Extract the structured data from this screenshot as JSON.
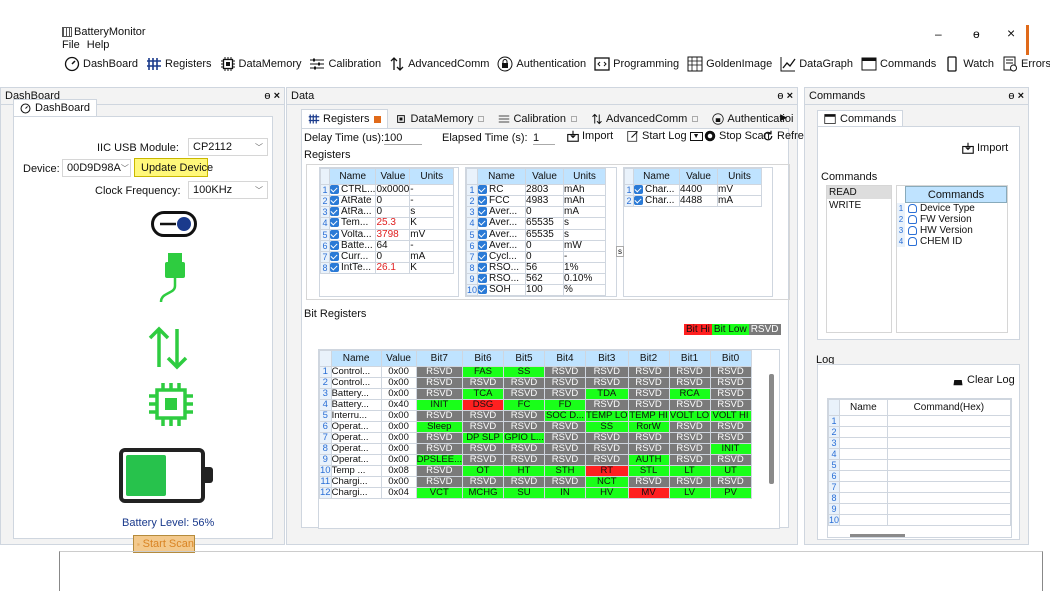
{
  "app": {
    "title": "BatteryMonitor",
    "minimize": "–",
    "maximize": "ɵ",
    "close": "×"
  },
  "menu": [
    "File",
    "Help"
  ],
  "toolbar": [
    "DashBoard",
    "Registers",
    "DataMemory",
    "Calibration",
    "AdvancedComm",
    "Authentication",
    "Programming",
    "GoldenImage",
    "DataGraph",
    "Commands",
    "Watch",
    "Errors"
  ],
  "dashboard": {
    "header": "DashBoard",
    "tab": "DashBoard",
    "iic_label": "IIC USB Module:",
    "iic_value": "CP2112",
    "device_label": "Device:",
    "device_value": "00D9D98A",
    "update_button": "Update Device",
    "clock_label": "Clock Frequency:",
    "clock_value": "100KHz",
    "battery_level_text": "Battery Level: 56%",
    "battery_level": 0.56,
    "start_scan": "Start Scan"
  },
  "data_panel": {
    "header": "Data",
    "tabs": [
      "Registers",
      "DataMemory",
      "Calibration",
      "AdvancedComm",
      "Authenticatioi"
    ],
    "delay_label": "Delay Time (us):",
    "delay_value": "100",
    "elapsed_label": "Elapsed Time (s):",
    "elapsed_value": "1",
    "import": "Import",
    "start_log": "Start Log",
    "stop_scan": "Stop Scan",
    "refresh": "Refresh",
    "registers_title": "Registers",
    "columns": [
      "Name",
      "Value",
      "Units"
    ],
    "table1": [
      {
        "name": "CTRL...",
        "value": "0x0000",
        "units": "-"
      },
      {
        "name": "AtRate",
        "value": "0",
        "units": "-"
      },
      {
        "name": "AtRa...",
        "value": "0",
        "units": "s"
      },
      {
        "name": "Tem...",
        "value": "25.3",
        "units": "K",
        "red": true
      },
      {
        "name": "Volta...",
        "value": "3798",
        "units": "mV",
        "red": true
      },
      {
        "name": "Batte...",
        "value": "64",
        "units": "-"
      },
      {
        "name": "Curr...",
        "value": "0",
        "units": "mA"
      },
      {
        "name": "IntTe...",
        "value": "26.1",
        "units": "K",
        "red": true
      }
    ],
    "table2": [
      {
        "name": "RC",
        "value": "2803",
        "units": "mAh"
      },
      {
        "name": "FCC",
        "value": "4983",
        "units": "mAh"
      },
      {
        "name": "Aver...",
        "value": "0",
        "units": "mA"
      },
      {
        "name": "Aver...",
        "value": "65535",
        "units": "s"
      },
      {
        "name": "Aver...",
        "value": "65535",
        "units": "s"
      },
      {
        "name": "Aver...",
        "value": "0",
        "units": "mW"
      },
      {
        "name": "Cycl...",
        "value": "0",
        "units": "-"
      },
      {
        "name": "RSO...",
        "value": "56",
        "units": "1%"
      },
      {
        "name": "RSO...",
        "value": "562",
        "units": "0.10%"
      },
      {
        "name": "SOH",
        "value": "100",
        "units": "%"
      }
    ],
    "table3": [
      {
        "name": "Char...",
        "value": "4400",
        "units": "mV"
      },
      {
        "name": "Char...",
        "value": "4488",
        "units": "mA"
      }
    ],
    "bit_title": "Bit Registers",
    "legend": [
      "Bit Hi",
      "Bit Low",
      "RSVD"
    ],
    "bit_columns": [
      "Name",
      "Value",
      "Bit7",
      "Bit6",
      "Bit5",
      "Bit4",
      "Bit3",
      "Bit2",
      "Bit1",
      "Bit0"
    ],
    "bit_rows": [
      {
        "name": "Control...",
        "value": "0x00",
        "bits": [
          [
            "RSVD",
            "r"
          ],
          [
            "FAS",
            "g"
          ],
          [
            "SS",
            "g"
          ],
          [
            "RSVD",
            "r"
          ],
          [
            "RSVD",
            "r"
          ],
          [
            "RSVD",
            "r"
          ],
          [
            "RSVD",
            "r"
          ],
          [
            "RSVD",
            "r"
          ]
        ]
      },
      {
        "name": "Control...",
        "value": "0x00",
        "bits": [
          [
            "RSVD",
            "r"
          ],
          [
            "RSVD",
            "r"
          ],
          [
            "RSVD",
            "r"
          ],
          [
            "RSVD",
            "r"
          ],
          [
            "RSVD",
            "r"
          ],
          [
            "RSVD",
            "r"
          ],
          [
            "RSVD",
            "r"
          ],
          [
            "RSVD",
            "r"
          ]
        ]
      },
      {
        "name": "Battery...",
        "value": "0x00",
        "bits": [
          [
            "RSVD",
            "r"
          ],
          [
            "TCA",
            "g"
          ],
          [
            "RSVD",
            "r"
          ],
          [
            "RSVD",
            "r"
          ],
          [
            "TDA",
            "g"
          ],
          [
            "RSVD",
            "r"
          ],
          [
            "RCA",
            "g"
          ],
          [
            "RSVD",
            "r"
          ]
        ]
      },
      {
        "name": "Battery...",
        "value": "0x40",
        "bits": [
          [
            "INIT",
            "g"
          ],
          [
            "DSG",
            "h"
          ],
          [
            "FC",
            "g"
          ],
          [
            "FD",
            "g"
          ],
          [
            "RSVD",
            "r"
          ],
          [
            "RSVD",
            "r"
          ],
          [
            "RSVD",
            "r"
          ],
          [
            "RSVD",
            "r"
          ]
        ]
      },
      {
        "name": "Interru...",
        "value": "0x00",
        "bits": [
          [
            "RSVD",
            "r"
          ],
          [
            "RSVD",
            "r"
          ],
          [
            "RSVD",
            "r"
          ],
          [
            "SOC D...",
            "g"
          ],
          [
            "TEMP LO",
            "g"
          ],
          [
            "TEMP HI",
            "g"
          ],
          [
            "VOLT LO",
            "g"
          ],
          [
            "VOLT HI",
            "g"
          ]
        ]
      },
      {
        "name": "Operat...",
        "value": "0x00",
        "bits": [
          [
            "Sleep",
            "g"
          ],
          [
            "RSVD",
            "r"
          ],
          [
            "RSVD",
            "r"
          ],
          [
            "RSVD",
            "r"
          ],
          [
            "SS",
            "g"
          ],
          [
            "RorW",
            "g"
          ],
          [
            "RSVD",
            "r"
          ],
          [
            "RSVD",
            "r"
          ]
        ]
      },
      {
        "name": "Operat...",
        "value": "0x00",
        "bits": [
          [
            "RSVD",
            "r"
          ],
          [
            "DP SLP",
            "g"
          ],
          [
            "GPIO L...",
            "g"
          ],
          [
            "RSVD",
            "r"
          ],
          [
            "RSVD",
            "r"
          ],
          [
            "RSVD",
            "r"
          ],
          [
            "RSVD",
            "r"
          ],
          [
            "RSVD",
            "r"
          ]
        ]
      },
      {
        "name": "Operat...",
        "value": "0x00",
        "bits": [
          [
            "RSVD",
            "r"
          ],
          [
            "RSVD",
            "r"
          ],
          [
            "RSVD",
            "r"
          ],
          [
            "RSVD",
            "r"
          ],
          [
            "RSVD",
            "r"
          ],
          [
            "RSVD",
            "r"
          ],
          [
            "RSVD",
            "r"
          ],
          [
            "INIT",
            "g"
          ]
        ]
      },
      {
        "name": "Operat...",
        "value": "0x00",
        "bits": [
          [
            "DPSLEE...",
            "g"
          ],
          [
            "RSVD",
            "r"
          ],
          [
            "RSVD",
            "r"
          ],
          [
            "RSVD",
            "r"
          ],
          [
            "RSVD",
            "r"
          ],
          [
            "AUTH",
            "g"
          ],
          [
            "RSVD",
            "r"
          ],
          [
            "RSVD",
            "r"
          ]
        ]
      },
      {
        "name": "Temp ...",
        "value": "0x08",
        "bits": [
          [
            "RSVD",
            "r"
          ],
          [
            "OT",
            "g"
          ],
          [
            "HT",
            "g"
          ],
          [
            "STH",
            "g"
          ],
          [
            "RT",
            "h"
          ],
          [
            "STL",
            "g"
          ],
          [
            "LT",
            "g"
          ],
          [
            "UT",
            "g"
          ]
        ]
      },
      {
        "name": "Chargi...",
        "value": "0x00",
        "bits": [
          [
            "RSVD",
            "r"
          ],
          [
            "RSVD",
            "r"
          ],
          [
            "RSVD",
            "r"
          ],
          [
            "RSVD",
            "r"
          ],
          [
            "NCT",
            "g"
          ],
          [
            "RSVD",
            "r"
          ],
          [
            "RSVD",
            "r"
          ],
          [
            "RSVD",
            "r"
          ]
        ]
      },
      {
        "name": "Chargi...",
        "value": "0x04",
        "bits": [
          [
            "VCT",
            "g"
          ],
          [
            "MCHG",
            "g"
          ],
          [
            "SU",
            "g"
          ],
          [
            "IN",
            "g"
          ],
          [
            "HV",
            "g"
          ],
          [
            "MV",
            "h"
          ],
          [
            "LV",
            "g"
          ],
          [
            "PV",
            "g"
          ]
        ]
      }
    ]
  },
  "commands_panel": {
    "header": "Commands",
    "tab": "Commands",
    "import": "Import",
    "group": "Commands",
    "list": [
      "READ",
      "WRITE"
    ],
    "cmd_header": "Commands",
    "cmds": [
      "Device Type",
      "FW Version",
      "HW Version",
      "CHEM ID"
    ],
    "log_title": "Log",
    "clear_log": "Clear Log",
    "log_columns": [
      "Name",
      "Command(Hex)"
    ],
    "log_rows": 10
  },
  "colors": {
    "accent": "#2a7ad6",
    "header_blue": "#bfe3ff",
    "rsvd": "#7a7a7a",
    "bit_low": "#19ff19",
    "bit_hi": "#ff2020",
    "orange": "#e06a1a"
  }
}
